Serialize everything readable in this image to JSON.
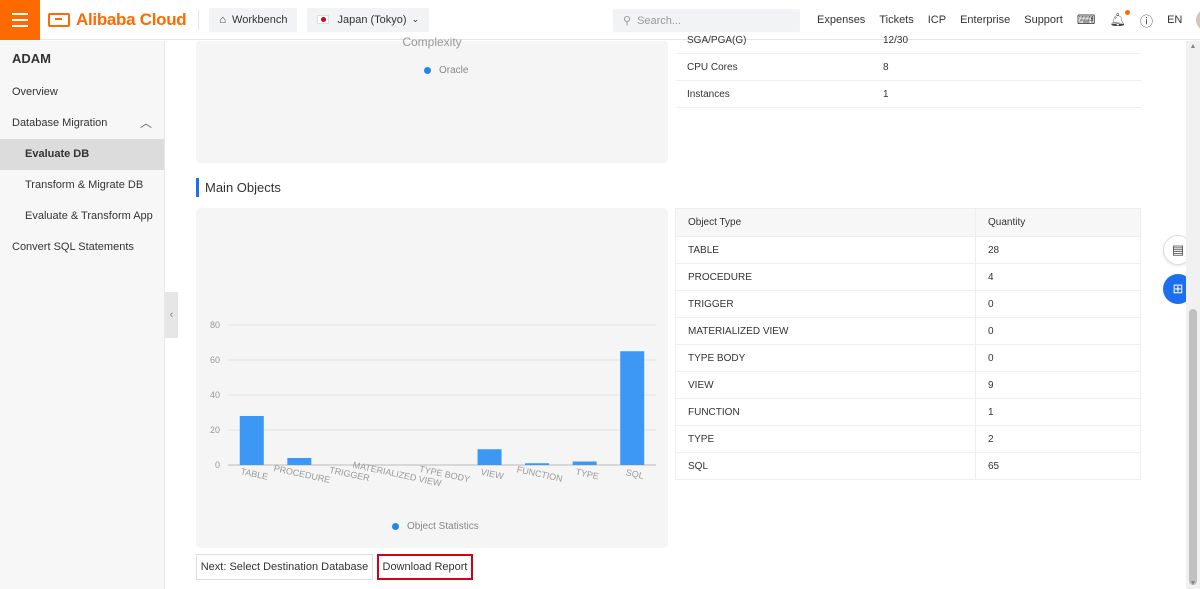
{
  "topbar": {
    "brand": "Alibaba Cloud",
    "workbench": "Workbench",
    "region": "Japan (Tokyo)",
    "search_placeholder": "Search...",
    "links": [
      "Expenses",
      "Tickets",
      "ICP",
      "Enterprise",
      "Support"
    ],
    "language": "EN"
  },
  "sidebar": {
    "title": "ADAM",
    "items": [
      {
        "label": "Overview"
      },
      {
        "label": "Database Migration"
      },
      {
        "label": "Evaluate DB"
      },
      {
        "label": "Transform & Migrate DB"
      },
      {
        "label": "Evaluate & Transform App"
      },
      {
        "label": "Convert SQL Statements"
      }
    ]
  },
  "complexity_card": {
    "title": "Complexity",
    "legend": "Oracle"
  },
  "summary_table": [
    {
      "key": "SGA/PGA(G)",
      "value": "12/30"
    },
    {
      "key": "CPU Cores",
      "value": "8"
    },
    {
      "key": "Instances",
      "value": "1"
    }
  ],
  "section": {
    "title": "Main Objects"
  },
  "chart_data": {
    "type": "bar",
    "categories": [
      "TABLE",
      "PROCEDURE",
      "TRIGGER",
      "MATERIALIZED VIEW",
      "TYPE BODY",
      "VIEW",
      "FUNCTION",
      "TYPE",
      "SQL"
    ],
    "series": [
      {
        "name": "Object Statistics",
        "values": [
          28,
          4,
          0,
          0,
          0,
          9,
          1,
          2,
          65
        ]
      }
    ],
    "y_ticks": [
      "0",
      "20",
      "40",
      "60",
      "80"
    ],
    "ylim": [
      0,
      80
    ],
    "legend": "bottom-center",
    "color": "#3d98f5"
  },
  "objects_table": {
    "headers": [
      "Object Type",
      "Quantity"
    ],
    "rows": [
      [
        "TABLE",
        "28"
      ],
      [
        "PROCEDURE",
        "4"
      ],
      [
        "TRIGGER",
        "0"
      ],
      [
        "MATERIALIZED VIEW",
        "0"
      ],
      [
        "TYPE BODY",
        "0"
      ],
      [
        "VIEW",
        "9"
      ],
      [
        "FUNCTION",
        "1"
      ],
      [
        "TYPE",
        "2"
      ],
      [
        "SQL",
        "65"
      ]
    ]
  },
  "buttons": {
    "next": "Next: Select Destination Database",
    "download": "Download Report"
  },
  "colors": {
    "brand": "#ff6a00",
    "accent": "#1e6ef0",
    "bar": "#3d98f5",
    "highlight": "#d0021b"
  }
}
